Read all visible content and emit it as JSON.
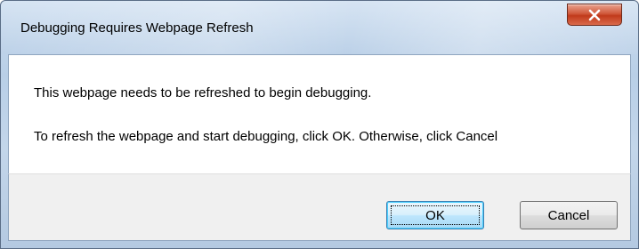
{
  "dialog": {
    "title": "Debugging Requires Webpage Refresh",
    "message_line1": "This webpage needs to be refreshed to begin debugging.",
    "message_line2": "To refresh the webpage and start debugging, click OK.  Otherwise, click Cancel",
    "buttons": {
      "ok_label": "OK",
      "cancel_label": "Cancel"
    }
  },
  "colors": {
    "close_button": "#c13a1b",
    "frame": "#bcd1e8",
    "ok_border": "#3c7fb1"
  },
  "icons": {
    "close": "close-icon"
  }
}
